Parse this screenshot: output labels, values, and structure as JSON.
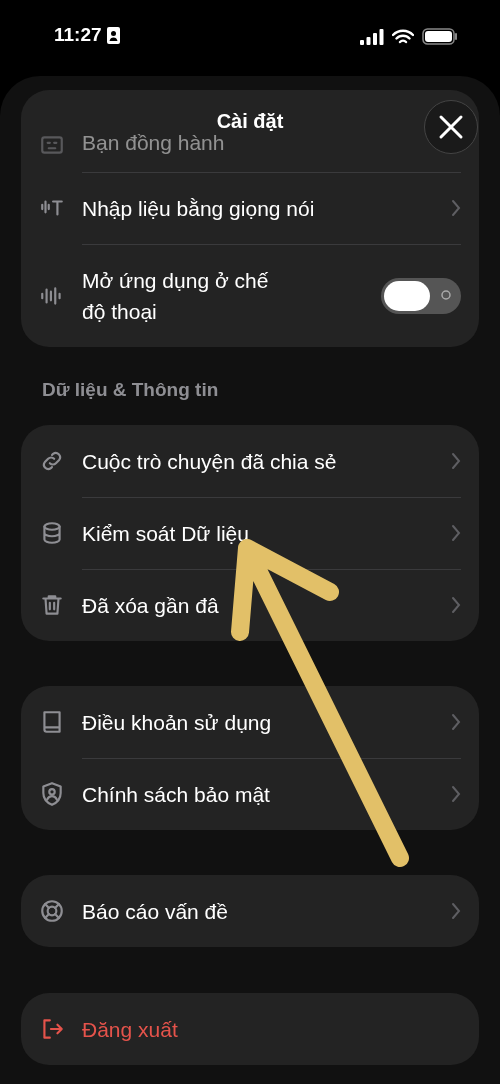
{
  "status_bar": {
    "time": "11:27"
  },
  "sheet": {
    "title": "Cài đặt"
  },
  "groups": [
    {
      "items": [
        {
          "kind": "link",
          "label": "Bạn đồng hành",
          "dimmed": true
        },
        {
          "kind": "link",
          "label": "Nhập liệu bằng giọng nói",
          "dimmed": false
        },
        {
          "kind": "toggle",
          "label": "Mở ứng dụng ở chế độ thoại",
          "dimmed": false,
          "on": false
        }
      ]
    },
    {
      "header": "Dữ liệu & Thông tin",
      "items": [
        {
          "kind": "link",
          "label": "Cuộc trò chuyện đã chia sẻ"
        },
        {
          "kind": "link",
          "label": "Kiểm soát Dữ liệu"
        },
        {
          "kind": "link",
          "label": "Đã xóa gần đâ"
        }
      ]
    },
    {
      "items": [
        {
          "kind": "link",
          "label": "Điều khoản sử dụng"
        },
        {
          "kind": "link",
          "label": "Chính sách bảo mật"
        }
      ]
    },
    {
      "items": [
        {
          "kind": "link",
          "label": "Báo cáo vấn đề"
        }
      ]
    },
    {
      "items": [
        {
          "kind": "danger",
          "label": "Đăng xuất"
        }
      ]
    }
  ]
}
